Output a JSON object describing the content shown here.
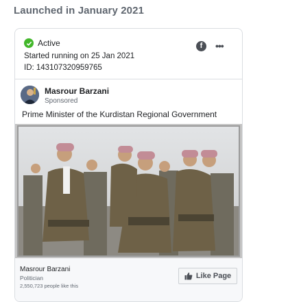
{
  "section": {
    "title": "Launched in January 2021"
  },
  "ad": {
    "status": "Active",
    "started": "Started running on 25 Jan 2021",
    "id_text": "ID: 143107320959765",
    "page_name": "Masrour Barzani",
    "sponsored": "Sponsored",
    "body_text": "Prime Minister of the Kurdistan Regional Government",
    "image_desc": "group-photo",
    "footer": {
      "name": "Masrour Barzani",
      "category": "Politician",
      "likes": "2,550,723 people like this",
      "like_button": "Like Page"
    }
  },
  "icons": {
    "status": "check-circle-icon",
    "platform": "facebook-icon",
    "more": "more-icon",
    "like": "thumbs-up-icon"
  },
  "colors": {
    "active_green": "#42b72a",
    "text_primary": "#1c1e21",
    "text_secondary": "#606770",
    "border": "#dadde1"
  }
}
